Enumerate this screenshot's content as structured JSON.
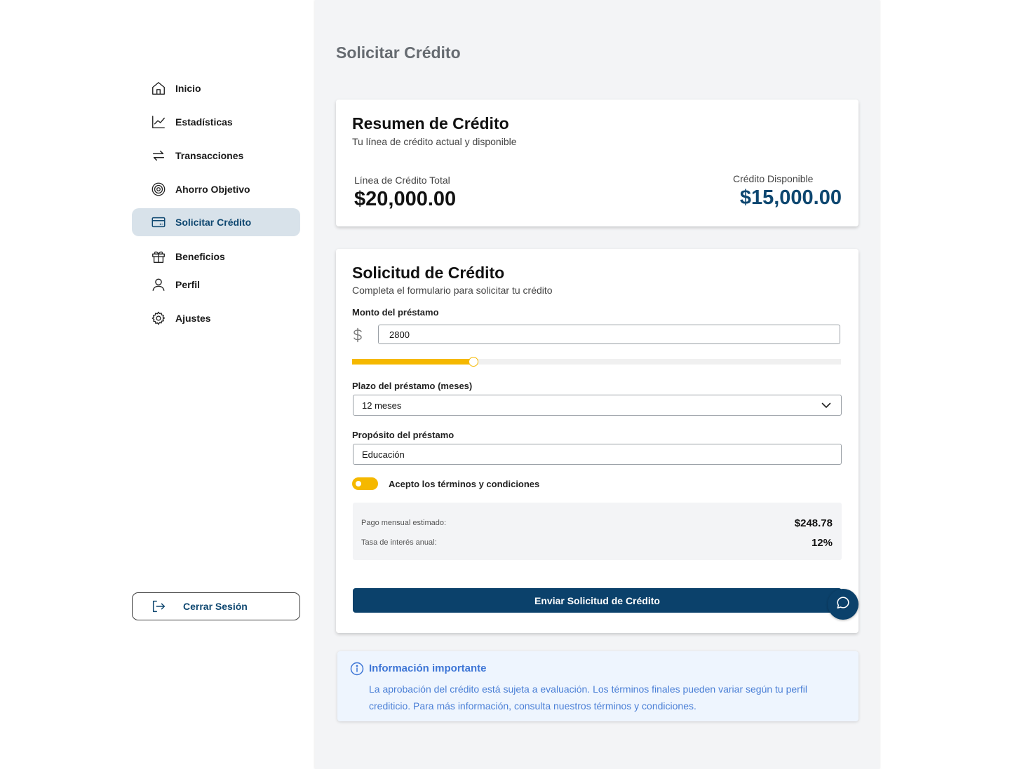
{
  "sidebar": {
    "items": [
      {
        "label": "Inicio",
        "icon": "home-icon"
      },
      {
        "label": "Estadísticas",
        "icon": "chart-line-icon"
      },
      {
        "label": "Transacciones",
        "icon": "transfer-icon"
      },
      {
        "label": "Ahorro Objetivo",
        "icon": "target-icon"
      },
      {
        "label": "Solicitar Crédito",
        "icon": "credit-card-icon",
        "active": true
      },
      {
        "label": "Beneficios",
        "icon": "gift-icon"
      },
      {
        "label": "Perfil",
        "icon": "user-icon"
      },
      {
        "label": "Ajustes",
        "icon": "settings-icon"
      }
    ],
    "logout_label": "Cerrar Sesión"
  },
  "page": {
    "title": "Solicitar Crédito"
  },
  "summary": {
    "title": "Resumen de Crédito",
    "subtitle": "Tu línea de crédito actual y disponible",
    "total_label": "Línea de Crédito Total",
    "total_value": "$20,000.00",
    "available_label": "Crédito Disponible",
    "available_value": "$15,000.00"
  },
  "form": {
    "title": "Solicitud de Crédito",
    "subtitle": "Completa el formulario para solicitar tu crédito",
    "amount_label": "Monto del préstamo",
    "amount_value": "2800",
    "slider_fraction": 0.247,
    "term_label": "Plazo del préstamo (meses)",
    "term_value": "12 meses",
    "purpose_label": "Propósito del préstamo",
    "purpose_value": "Educación",
    "terms_label": "Acepto los términos y condiciones",
    "monthly_label": "Pago mensual estimado:",
    "monthly_value": "$248.78",
    "rate_label": "Tasa de interés anual:",
    "rate_value": "12%",
    "submit_label": "Enviar Solicitud de Crédito"
  },
  "info": {
    "title": "Información importante",
    "text": "La aprobación del crédito está sujeta a evaluación. Los términos finales pueden variar según tu perfil crediticio. Para más información, consulta nuestros términos y condiciones."
  },
  "colors": {
    "accent": "#f5b800",
    "primary": "#0b416b",
    "active_bg": "#d8e2ea",
    "info": "#3e76d6"
  }
}
